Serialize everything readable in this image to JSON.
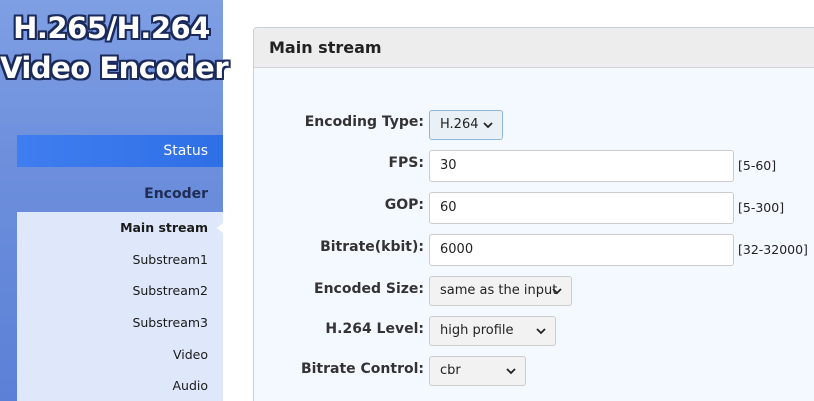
{
  "logo": {
    "line1": "H.265/H.264",
    "line2": "Video Encoder"
  },
  "nav": {
    "status": "Status",
    "encoder": "Encoder",
    "sub_items": [
      "Main stream",
      "Substream1",
      "Substream2",
      "Substream3",
      "Video",
      "Audio"
    ],
    "active_index": 0
  },
  "panel": {
    "title": "Main stream",
    "fields": {
      "encoding_type": {
        "label": "Encoding Type:",
        "value": "H.264"
      },
      "fps": {
        "label": "FPS:",
        "value": "30",
        "range": "[5-60]"
      },
      "gop": {
        "label": "GOP:",
        "value": "60",
        "range": "[5-300]"
      },
      "bitrate": {
        "label": "Bitrate(kbit):",
        "value": "6000",
        "range": "[32-32000]"
      },
      "encoded_size": {
        "label": "Encoded Size:",
        "value": "same as the input"
      },
      "level": {
        "label": "H.264 Level:",
        "value": "high profile"
      },
      "bitrate_control": {
        "label": "Bitrate Control:",
        "value": "cbr"
      }
    }
  },
  "colors": {
    "sidebar": "#6d8fdc",
    "nav_active": "#2f6fe6",
    "subnav_bg": "#dfe7fb",
    "panel_bg": "#f4f8ff"
  }
}
